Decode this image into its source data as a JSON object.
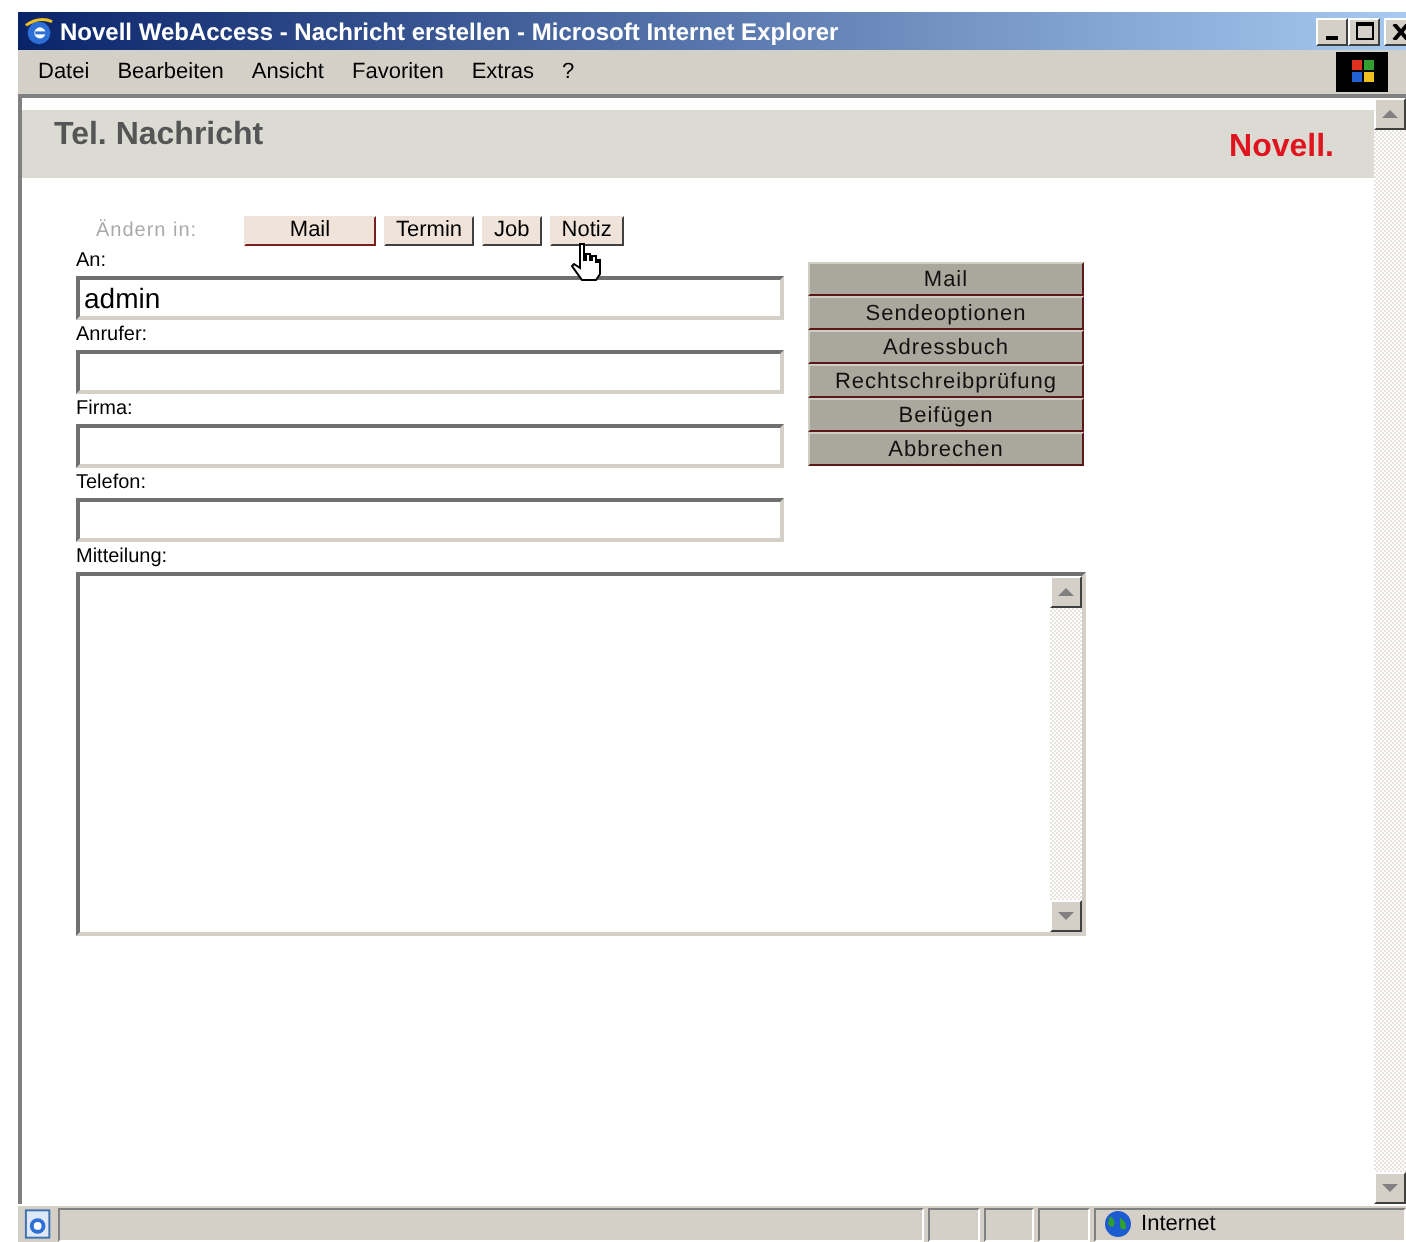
{
  "window": {
    "title": "Novell WebAccess - Nachricht erstellen - Microsoft Internet Explorer"
  },
  "menu": [
    "Datei",
    "Bearbeiten",
    "Ansicht",
    "Favoriten",
    "Extras",
    "?"
  ],
  "header": {
    "title": "Tel. Nachricht",
    "logo": "Novell."
  },
  "change_to": {
    "label": "Ändern in:",
    "tabs": [
      {
        "label": "Mail",
        "selected": true
      },
      {
        "label": "Termin",
        "selected": false
      },
      {
        "label": "Job",
        "selected": false
      },
      {
        "label": "Notiz",
        "selected": false
      }
    ]
  },
  "fields": [
    {
      "label": "An:",
      "value": "admin"
    },
    {
      "label": "Anrufer:"
    },
    {
      "label": "Firma:"
    },
    {
      "label": "Telefon:"
    }
  ],
  "actions": [
    "Mail",
    "Sendeoptionen",
    "Adressbuch",
    "Rechtschreibprüfung",
    "Beifügen",
    "Abbrechen"
  ],
  "message": {
    "label": "Mitteilung:"
  },
  "status_bar": {
    "zone": "Internet"
  }
}
